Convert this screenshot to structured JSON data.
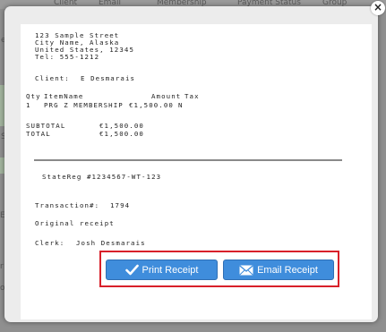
{
  "background": {
    "top_tabs": [
      "Client",
      "Email",
      "Membership",
      "Payment Status",
      "Group"
    ],
    "side_fragments": [
      "e",
      "S",
      "ES",
      "r",
      "on"
    ]
  },
  "modal": {
    "close_glyph": "×",
    "receipt": {
      "address": [
        "123 Sample Street",
        "City Name, Alaska",
        "United States, 12345",
        "Tel: 555-1212"
      ],
      "client_label": "Client:",
      "client_name": "E Desmarais",
      "headers": {
        "qty": "Qty",
        "item": "ItemName",
        "amount": "Amount",
        "tax": "Tax"
      },
      "items": [
        {
          "qty": "1",
          "name": "PRG Z MEMBERSHIP",
          "amount": "€1,500.00",
          "tax": "N"
        }
      ],
      "subtotal_label": "SUBTOTAL",
      "subtotal_value": "€1,500.00",
      "total_label": "TOTAL",
      "total_value": "€1,500.00",
      "state_reg": "StateReg #1234567-WT-123",
      "transaction_label": "Transaction#:",
      "transaction_number": "1794",
      "receipt_type": "Original receipt",
      "clerk_label": "Clerk:",
      "clerk_name": "Josh Desmarais"
    },
    "buttons": {
      "print_label": "Print Receipt",
      "email_label": "Email Receipt"
    },
    "colors": {
      "button": "#3f8ddc",
      "highlight": "#d8202a"
    }
  }
}
